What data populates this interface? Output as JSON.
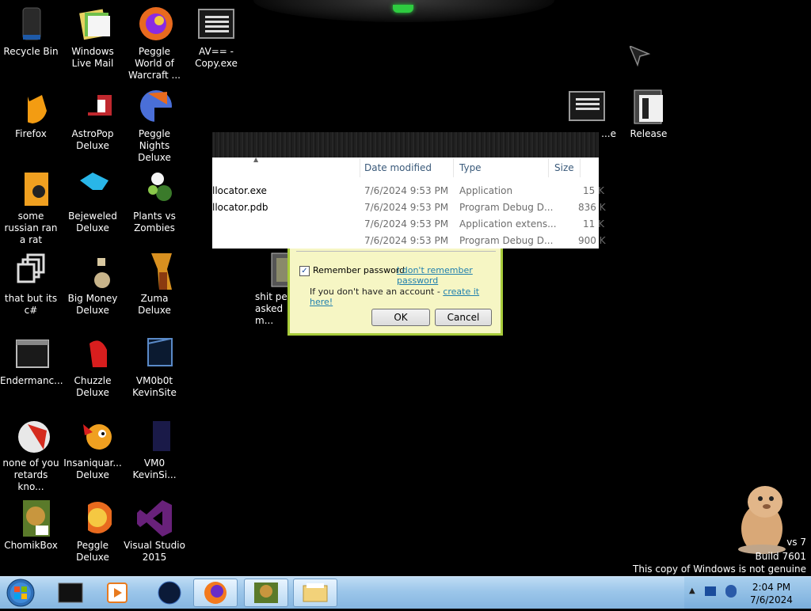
{
  "desktop": {
    "icons": [
      {
        "label": "Recycle Bin"
      },
      {
        "label": "Windows Live Mail"
      },
      {
        "label": "Peggle World of Warcraft ..."
      },
      {
        "label": "AV== - Copy.exe"
      },
      {
        "label": "Firefox"
      },
      {
        "label": "AstroPop Deluxe"
      },
      {
        "label": "Peggle Nights Deluxe"
      },
      {
        "label": "some russian ran a rat"
      },
      {
        "label": "Bejeweled Deluxe"
      },
      {
        "label": "Plants vs Zombies"
      },
      {
        "label": "that but its c#"
      },
      {
        "label": "Big Money Deluxe"
      },
      {
        "label": "Zuma Deluxe"
      },
      {
        "label": "Endermanc..."
      },
      {
        "label": "Chuzzle Deluxe"
      },
      {
        "label": "VM0b0t KevinSite"
      },
      {
        "label": "none of you retards kno..."
      },
      {
        "label": "Insaniquar... Deluxe"
      },
      {
        "label": "VM0 KevinSi..."
      },
      {
        "label": "ChomikBox"
      },
      {
        "label": "Peggle Deluxe"
      },
      {
        "label": "Visual Studio 2015"
      },
      {
        "label": "Release"
      },
      {
        "label": "...e"
      },
      {
        "label": "shit peo... asked m..."
      }
    ]
  },
  "explorer": {
    "columns": [
      "Date modified",
      "Type",
      "Size"
    ],
    "rows": [
      {
        "name": "llocator.exe",
        "date": "7/6/2024 9:53 PM",
        "type": "Application",
        "size": "15 K"
      },
      {
        "name": "llocator.pdb",
        "date": "7/6/2024 9:53 PM",
        "type": "Program Debug D...",
        "size": "836 K"
      },
      {
        "name": "",
        "date": "7/6/2024 9:53 PM",
        "type": "Application extens...",
        "size": "11 K"
      },
      {
        "name": "",
        "date": "7/6/2024 9:53 PM",
        "type": "Program Debug D...",
        "size": "900 K"
      }
    ]
  },
  "login_dialog": {
    "remember_label": "Remember password",
    "forgot_link": "I don't remember password",
    "no_account_text": "If you don't have an account - ",
    "create_link": "create it here!",
    "ok_label": "OK",
    "cancel_label": "Cancel"
  },
  "watermark": {
    "line1": "vs 7",
    "line2": "Build 7601",
    "line3": "This copy of Windows is not genuine"
  },
  "taskbar": {
    "time": "2:04 PM",
    "date": "7/6/2024",
    "start_icon": "windows-orb-icon",
    "pinned": [
      "cmd-icon",
      "media-player-icon",
      "globe-icon",
      "firefox-icon",
      "chomikbox-icon",
      "explorer-folder-icon"
    ]
  },
  "colors": {
    "dialog_bg": "#f6f6c4",
    "dialog_border": "#a8cc3a",
    "link": "#1f7fae",
    "taskbar": "#9cc6ea"
  }
}
